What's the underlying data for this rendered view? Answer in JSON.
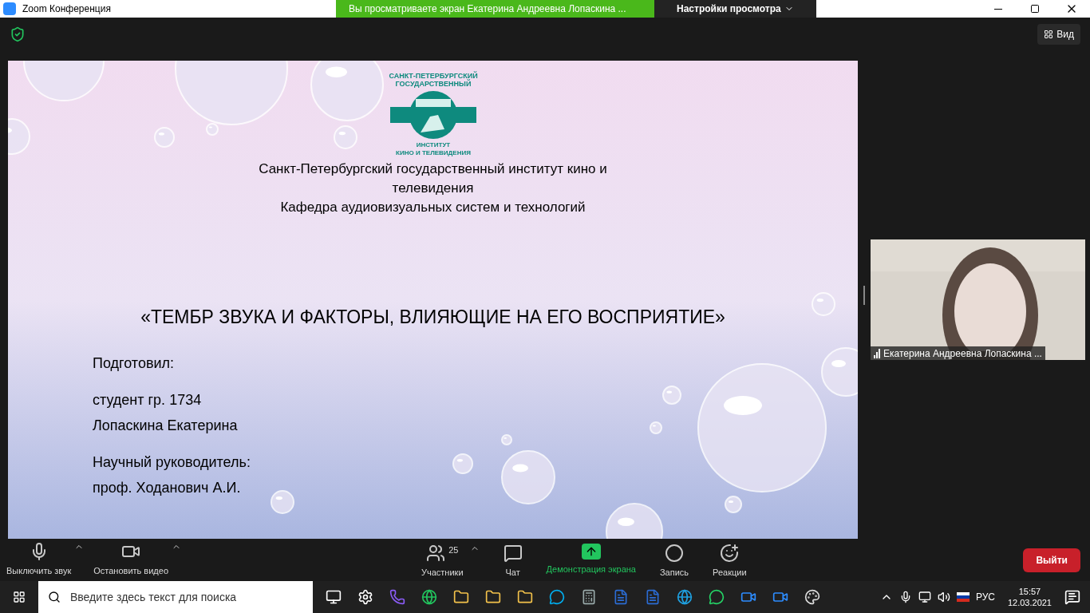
{
  "window": {
    "title": "Zoom Конференция",
    "share_banner": "Вы просматриваете экран Екатерина Андреевна Лопаскина ...",
    "view_options": "Настройки просмотра"
  },
  "top_bar": {
    "view_button": "Вид"
  },
  "slide": {
    "logo_top": [
      "САНКТ-ПЕТЕРБУРГСКИЙ",
      "ГОСУДАРСТВЕННЫЙ"
    ],
    "logo_bottom_1": "ИНСТИТУТ",
    "logo_bottom_2": "КИНО И ТЕЛЕВИДЕНИЯ",
    "header_lines": [
      "Санкт-Петербургский государственный институт кино и",
      "телевидения",
      "Кафедра аудиовизуальных систем и технологий"
    ],
    "title": "«ТЕМБР ЗВУКА И ФАКТОРЫ, ВЛИЯЮЩИЕ НА ЕГО ВОСПРИЯТИЕ»",
    "blocks": [
      [
        "Подготовил:"
      ],
      [
        "студент гр. 1734",
        "Лопаскина Екатерина"
      ],
      [
        "Научный руководитель:",
        "проф. Ходанович А.И."
      ]
    ]
  },
  "video": {
    "name": "Екатерина Андреевна Лопаскина ..."
  },
  "toolbar": {
    "left": [
      {
        "kind": "mic",
        "label": "Выключить звук"
      },
      {
        "kind": "camera",
        "label": "Остановить видео"
      }
    ],
    "center": [
      {
        "kind": "participants",
        "label": "Участники",
        "count": "25"
      },
      {
        "kind": "chat",
        "label": "Чат"
      },
      {
        "kind": "share",
        "label": "Демонстрация экрана"
      },
      {
        "kind": "record",
        "label": "Запись"
      },
      {
        "kind": "reactions",
        "label": "Реакции"
      }
    ],
    "leave": "Выйти"
  },
  "taskbar": {
    "search_placeholder": "Введите здесь текст для поиска",
    "language": "РУС",
    "time": "15:57",
    "date": "12.03.2021"
  }
}
